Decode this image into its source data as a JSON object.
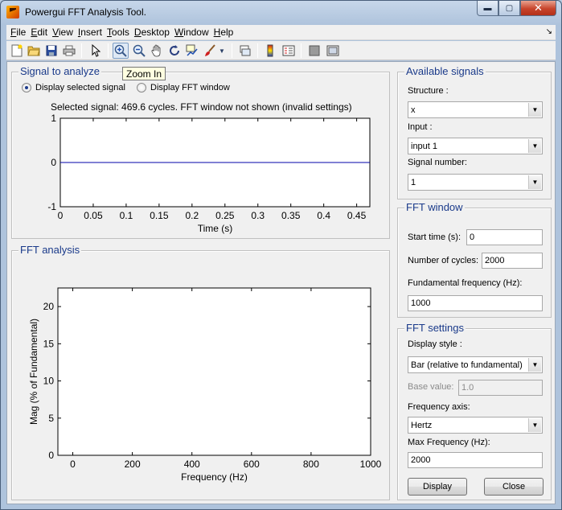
{
  "window": {
    "title": "Powergui FFT Analysis Tool.",
    "controls": {
      "minimize": "▬",
      "maximize": "▢",
      "close": "✕"
    }
  },
  "menubar": {
    "items": [
      {
        "label": "File",
        "mnemonic": "F",
        "rest": "ile"
      },
      {
        "label": "Edit",
        "mnemonic": "E",
        "rest": "dit"
      },
      {
        "label": "View",
        "mnemonic": "V",
        "rest": "iew"
      },
      {
        "label": "Insert",
        "mnemonic": "I",
        "rest": "nsert"
      },
      {
        "label": "Tools",
        "mnemonic": "T",
        "rest": "ools"
      },
      {
        "label": "Desktop",
        "mnemonic": "D",
        "rest": "esktop"
      },
      {
        "label": "Window",
        "mnemonic": "W",
        "rest": "indow"
      },
      {
        "label": "Help",
        "mnemonic": "H",
        "rest": "elp"
      }
    ],
    "overflow_icon": "↘"
  },
  "toolbar": {
    "icons": [
      "new-file-icon",
      "open-folder-icon",
      "save-icon",
      "print-icon",
      "pointer-icon",
      "zoom-in-icon",
      "zoom-out-icon",
      "pan-icon",
      "rotate-icon",
      "data-cursor-icon",
      "brush-icon",
      "brush-dropdown-icon",
      "link-icon",
      "colorbar-icon",
      "legend-icon",
      "hide-plot-tools-icon",
      "show-plot-tools-icon"
    ],
    "tooltip": "Zoom In"
  },
  "signal_panel": {
    "title": "Signal to analyze",
    "radio_selected": "Display selected signal",
    "radio_fft": "Display FFT window",
    "status": "Selected signal: 469.6 cycles. FFT window not shown (invalid settings)"
  },
  "fft_panel": {
    "title": "FFT analysis"
  },
  "available_signals": {
    "title": "Available signals",
    "structure_label": "Structure :",
    "structure_value": "x",
    "input_label": "Input :",
    "input_value": "input 1",
    "signal_number_label": "Signal number:",
    "signal_number_value": "1"
  },
  "fft_window": {
    "title": "FFT window",
    "start_time_label": "Start time (s):",
    "start_time_value": "0",
    "cycles_label": "Number of cycles:",
    "cycles_value": "2000",
    "fundamental_label": "Fundamental frequency (Hz):",
    "fundamental_value": "1000"
  },
  "fft_settings": {
    "title": "FFT settings",
    "display_style_label": "Display style :",
    "display_style_value": "Bar (relative to fundamental)",
    "base_value_label": "Base value:",
    "base_value_value": "1.0",
    "frequency_axis_label": "Frequency axis:",
    "frequency_axis_value": "Hertz",
    "max_frequency_label": "Max Frequency (Hz):",
    "max_frequency_value": "2000",
    "display_button": "Display",
    "close_button": "Close"
  },
  "chart_data": [
    {
      "type": "line",
      "title": "",
      "xlabel": "Time (s)",
      "ylabel": "",
      "xlim": [
        0,
        0.47
      ],
      "ylim": [
        -1,
        1
      ],
      "xticks": [
        0,
        0.05,
        0.1,
        0.15,
        0.2,
        0.25,
        0.3,
        0.35,
        0.4,
        0.45
      ],
      "xtick_labels": [
        "0",
        "0.05",
        "0.1",
        "0.15",
        "0.2",
        "0.25",
        "0.3",
        "0.35",
        "0.4",
        "0.45"
      ],
      "yticks": [
        -1,
        0,
        1
      ],
      "ytick_labels": [
        "-1",
        "0",
        "1"
      ],
      "series": [
        {
          "x": [
            0,
            0.47
          ],
          "y": [
            0,
            0
          ],
          "color": "#0000aa"
        }
      ],
      "grid": false
    },
    {
      "type": "bar",
      "title": "",
      "xlabel": "Frequency (Hz)",
      "ylabel": "Mag (% of Fundamental)",
      "xlim": [
        -50,
        1000
      ],
      "ylim": [
        0,
        22.5
      ],
      "xticks": [
        0,
        200,
        400,
        600,
        800,
        1000
      ],
      "xtick_labels": [
        "0",
        "200",
        "400",
        "600",
        "800",
        "1000"
      ],
      "yticks": [
        0,
        5,
        10,
        15,
        20
      ],
      "ytick_labels": [
        "0",
        "5",
        "10",
        "15",
        "20"
      ],
      "series": [],
      "grid": false
    }
  ]
}
